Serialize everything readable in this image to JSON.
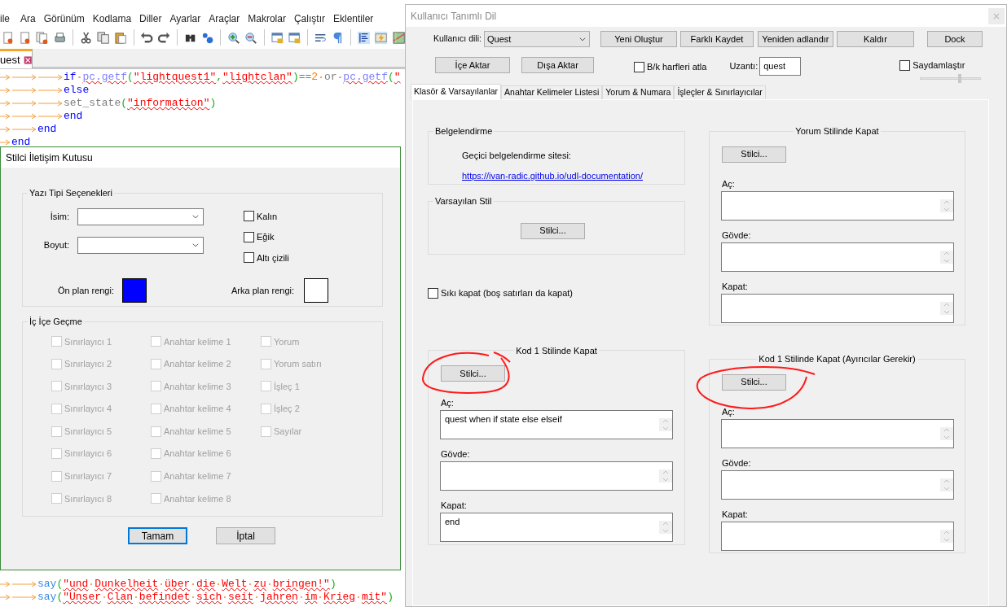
{
  "editor": {
    "menu": [
      "ile",
      "Ara",
      "Görünüm",
      "Kodlama",
      "Diller",
      "Ayarlar",
      "Araçlar",
      "Makrolar",
      "Çalıştır",
      "Eklentiler"
    ],
    "tab": {
      "label": "uest",
      "selected": true
    },
    "code_top": [
      {
        "tokens": [
          {
            "kind": "tab"
          },
          {
            "kind": "tab"
          },
          {
            "kind": "tab"
          },
          {
            "kind": "keyword",
            "text": "if"
          },
          {
            "kind": "space"
          },
          {
            "kind": "call",
            "text": "pc.getf"
          },
          {
            "kind": "paren",
            "text": "("
          },
          {
            "kind": "string",
            "text": "\"lightquest1\""
          },
          {
            "kind": "operator",
            "text": ","
          },
          {
            "kind": "string",
            "text": "\"lightclan\""
          },
          {
            "kind": "paren",
            "text": ")"
          },
          {
            "kind": "operator",
            "text": "=="
          },
          {
            "kind": "number",
            "text": "2"
          },
          {
            "kind": "space"
          },
          {
            "kind": "word",
            "text": "or"
          },
          {
            "kind": "space"
          },
          {
            "kind": "call",
            "text": "pc.getf"
          },
          {
            "kind": "paren",
            "text": "("
          },
          {
            "kind": "string",
            "text": "\""
          }
        ]
      },
      {
        "tokens": [
          {
            "kind": "tab"
          },
          {
            "kind": "tab"
          },
          {
            "kind": "tab"
          },
          {
            "kind": "keyword",
            "text": "else"
          }
        ]
      },
      {
        "tokens": [
          {
            "kind": "tab"
          },
          {
            "kind": "tab"
          },
          {
            "kind": "tab"
          },
          {
            "kind": "word",
            "text": "set_state"
          },
          {
            "kind": "paren",
            "text": "("
          },
          {
            "kind": "string",
            "text": "\"information\""
          },
          {
            "kind": "paren",
            "text": ")"
          }
        ]
      },
      {
        "tokens": [
          {
            "kind": "tab"
          },
          {
            "kind": "tab"
          },
          {
            "kind": "tab"
          },
          {
            "kind": "keyword",
            "text": "end"
          }
        ]
      },
      {
        "tokens": [
          {
            "kind": "tab"
          },
          {
            "kind": "tab"
          },
          {
            "kind": "keyword",
            "text": "end"
          }
        ]
      },
      {
        "tokens": [
          {
            "kind": "tab"
          },
          {
            "kind": "keyword",
            "text": "end"
          }
        ]
      }
    ],
    "code_bottom": [
      {
        "tokens": [
          {
            "kind": "tab"
          },
          {
            "kind": "tab"
          },
          {
            "kind": "say",
            "text": "say"
          },
          {
            "kind": "paren",
            "text": "("
          },
          {
            "kind": "string",
            "text": "\"und Dunkelheit über die Welt zu bringen!\""
          },
          {
            "kind": "paren",
            "text": ")"
          }
        ]
      },
      {
        "tokens": [
          {
            "kind": "tab"
          },
          {
            "kind": "tab"
          },
          {
            "kind": "say",
            "text": "say"
          },
          {
            "kind": "paren",
            "text": "("
          },
          {
            "kind": "string",
            "text": "\"Unser Clan befindet sich seit jahren im Krieg mit\""
          },
          {
            "kind": "paren",
            "text": ")"
          }
        ]
      }
    ]
  },
  "style_dialog": {
    "title": "Stilci İletişim Kutusu",
    "font_group": {
      "title": "Yazı Tipi Seçenekleri",
      "fields": [
        {
          "label": "İsim:"
        },
        {
          "label": "Boyut:"
        }
      ],
      "checkboxes": [
        {
          "label": "Kalın",
          "checked": false
        },
        {
          "label": "Eğik",
          "checked": false
        },
        {
          "label": "Altı çizili",
          "checked": false
        }
      ],
      "foreground": {
        "label": "Ön plan rengi:",
        "color": "#0000ff"
      },
      "background": {
        "label": "Arka plan rengi:",
        "color": "#ffffff"
      }
    },
    "nesting_group": {
      "title": "İç İçe Geçme",
      "columns": [
        [
          {
            "label": "Sınırlayıcı 1",
            "checked": false,
            "disabled": true
          },
          {
            "label": "Sınırlayıcı 2",
            "checked": false,
            "disabled": true
          },
          {
            "label": "Sınırlayıcı 3",
            "checked": false,
            "disabled": true
          },
          {
            "label": "Sınırlayıcı 4",
            "checked": false,
            "disabled": true
          },
          {
            "label": "Sınırlayıcı 5",
            "checked": false,
            "disabled": true
          },
          {
            "label": "Sınırlayıcı 6",
            "checked": false,
            "disabled": true
          },
          {
            "label": "Sınırlayıcı 7",
            "checked": false,
            "disabled": true
          },
          {
            "label": "Sınırlayıcı 8",
            "checked": false,
            "disabled": true
          }
        ],
        [
          {
            "label": "Anahtar kelime 1",
            "checked": false,
            "disabled": true
          },
          {
            "label": "Anahtar kelime 2",
            "checked": false,
            "disabled": true
          },
          {
            "label": "Anahtar kelime 3",
            "checked": false,
            "disabled": true
          },
          {
            "label": "Anahtar kelime 4",
            "checked": false,
            "disabled": true
          },
          {
            "label": "Anahtar kelime 5",
            "checked": false,
            "disabled": true
          },
          {
            "label": "Anahtar kelime 6",
            "checked": false,
            "disabled": true
          },
          {
            "label": "Anahtar kelime 7",
            "checked": false,
            "disabled": true
          },
          {
            "label": "Anahtar kelime 8",
            "checked": false,
            "disabled": true
          }
        ],
        [
          {
            "label": "Yorum",
            "checked": false,
            "disabled": true
          },
          {
            "label": "Yorum satırı",
            "checked": false,
            "disabled": true
          },
          {
            "label": "İşleç 1",
            "checked": false,
            "disabled": true
          },
          {
            "label": "İşleç 2",
            "checked": false,
            "disabled": true
          },
          {
            "label": "Sayılar",
            "checked": false,
            "disabled": true
          }
        ]
      ]
    },
    "buttons": [
      {
        "label": "Tamam",
        "focused": true
      },
      {
        "label": "İptal",
        "focused": false
      }
    ]
  },
  "udl_window": {
    "title": "Kullanıcı Tanımlı Dil",
    "language_label": "Kullanıcı dili:",
    "language": "Quest",
    "buttons_row1": [
      "Yeni Oluştur",
      "Farklı Kaydet",
      "Yeniden adlandır",
      "Kaldır",
      "Dock"
    ],
    "buttons_row2": [
      "İçe Aktar",
      "Dışa Aktar"
    ],
    "ignore_case": {
      "label": "B/k harfleri atla",
      "checked": false
    },
    "extension": {
      "label": "Uzantı:",
      "value": "quest"
    },
    "transparency": {
      "label": "Saydamlaştır",
      "checked": false,
      "level": 0.65
    },
    "tabs": [
      {
        "label": "Klasör & Varsayılanlar",
        "selected": true
      },
      {
        "label": "Anahtar Kelimeler Listesi",
        "selected": false
      },
      {
        "label": "Yorum & Numara",
        "selected": false
      },
      {
        "label": "İşleçler & Sınırlayıcılar",
        "selected": false
      }
    ],
    "documentation": {
      "title": "Belgelendirme",
      "text": "Geçici belgelendirme sitesi:",
      "link": "https://ivan-radic.github.io/udl-documentation/"
    },
    "default_style": {
      "title": "Varsayılan Stil",
      "button": "Stilci..."
    },
    "strict_fold": {
      "label": "Sıkı kapat (boş satırları da kapat)",
      "checked": false
    },
    "fold_groups": [
      {
        "title": "Yorum Stilinde Kapat",
        "button": "Stilci...",
        "fields": [
          {
            "label": "Aç:"
          },
          {
            "label": "Gövde:"
          },
          {
            "label": "Kapat:"
          }
        ]
      },
      {
        "title": "Kod 1 Stilinde Kapat",
        "button": "Stilci...",
        "fields": [
          {
            "label": "Aç:",
            "value": "quest when if state else elseif"
          },
          {
            "label": "Gövde:"
          },
          {
            "label": "Kapat:",
            "value": "end"
          }
        ]
      },
      {
        "title": "Kod 1 Stilinde Kapat (Ayırıcılar Gerekir)",
        "button": "Stilci...",
        "fields": [
          {
            "label": "Aç:"
          },
          {
            "label": "Gövde:"
          },
          {
            "label": "Kapat:"
          }
        ]
      }
    ]
  }
}
